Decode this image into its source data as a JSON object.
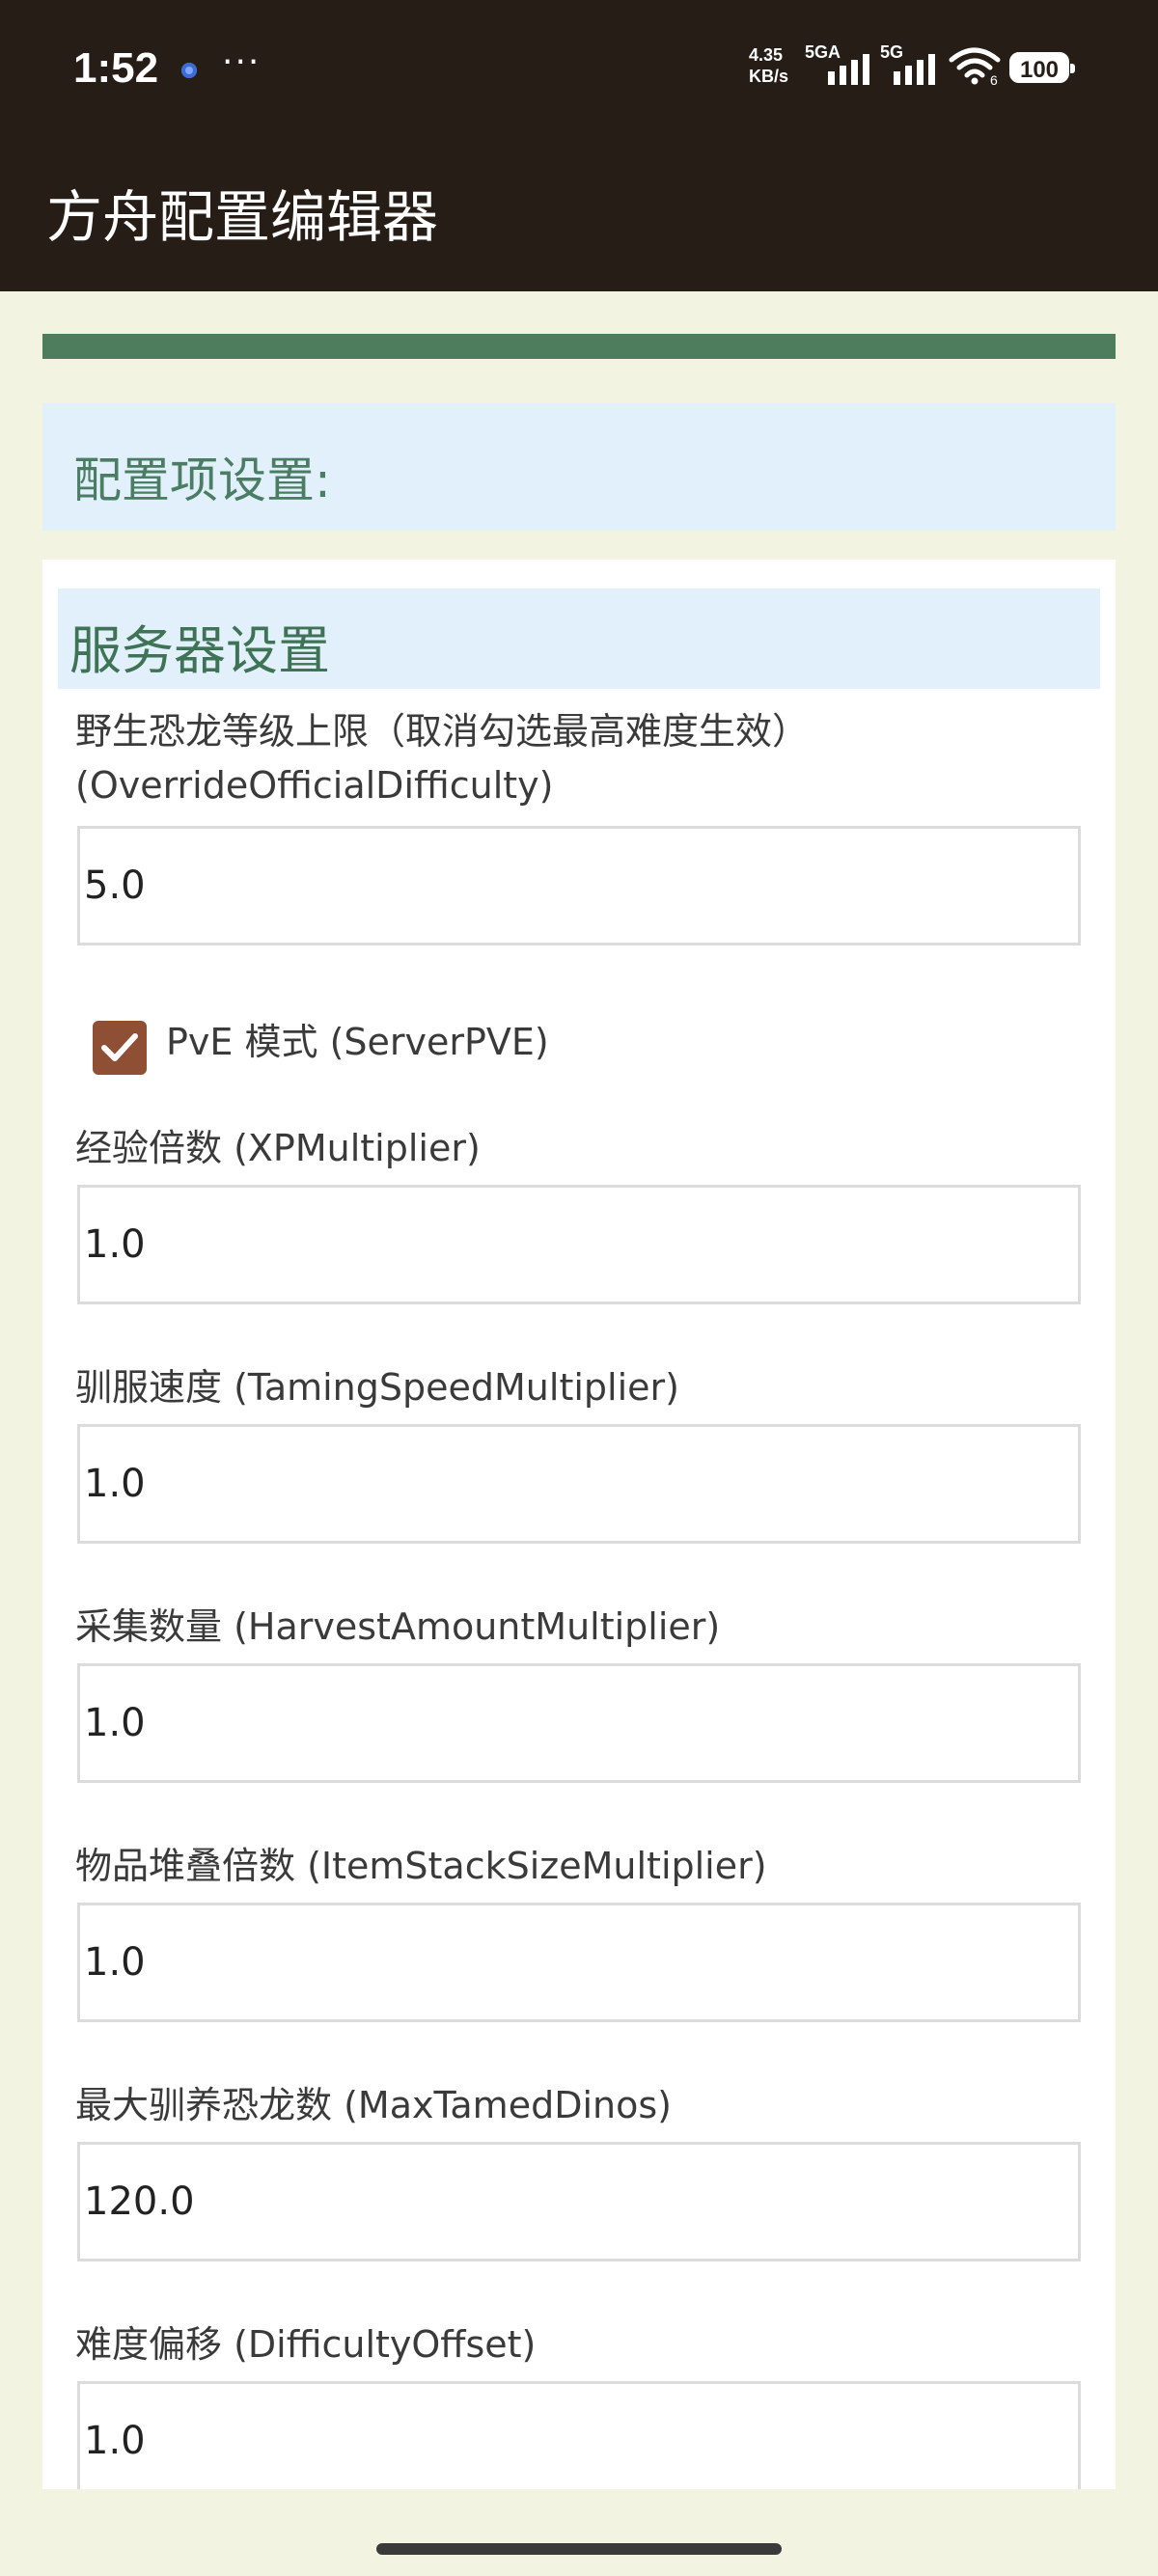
{
  "status_bar": {
    "time": "1:52",
    "more": "···",
    "net_speed_value": "4.35",
    "net_speed_unit": "KB/s",
    "sim1": "5GA",
    "sim2": "5G",
    "wifi_badge": "6",
    "battery": "100"
  },
  "app": {
    "title": "方舟配置编辑器"
  },
  "progress": {
    "fraction": 1.0,
    "color": "#4e7d5e"
  },
  "config": {
    "header": "配置项设置:",
    "section_title": "服务器设置",
    "fields": [
      {
        "label": "野生恐龙等级上限（取消勾选最高难度生效）",
        "label2": "(OverrideOfficialDifficulty)",
        "value": "5.0"
      },
      {
        "label": "经验倍数 (XPMultiplier)",
        "value": "1.0"
      },
      {
        "label": "驯服速度 (TamingSpeedMultiplier)",
        "value": "1.0"
      },
      {
        "label": "采集数量 (HarvestAmountMultiplier)",
        "value": "1.0"
      },
      {
        "label": "物品堆叠倍数 (ItemStackSizeMultiplier)",
        "value": "1.0"
      },
      {
        "label": "最大驯养恐龙数 (MaxTamedDinos)",
        "value": "120.0"
      },
      {
        "label": "难度偏移 (DifficultyOffset)",
        "value": "1.0"
      }
    ],
    "pve": {
      "label": "PvE 模式 (ServerPVE)",
      "checked": true
    }
  },
  "colors": {
    "app_bar": "#261d17",
    "accent_green": "#4e7d5e",
    "header_bg": "#e1f0fa",
    "checkbox": "#8f4f34",
    "page_bg": "#f2f3e1"
  }
}
